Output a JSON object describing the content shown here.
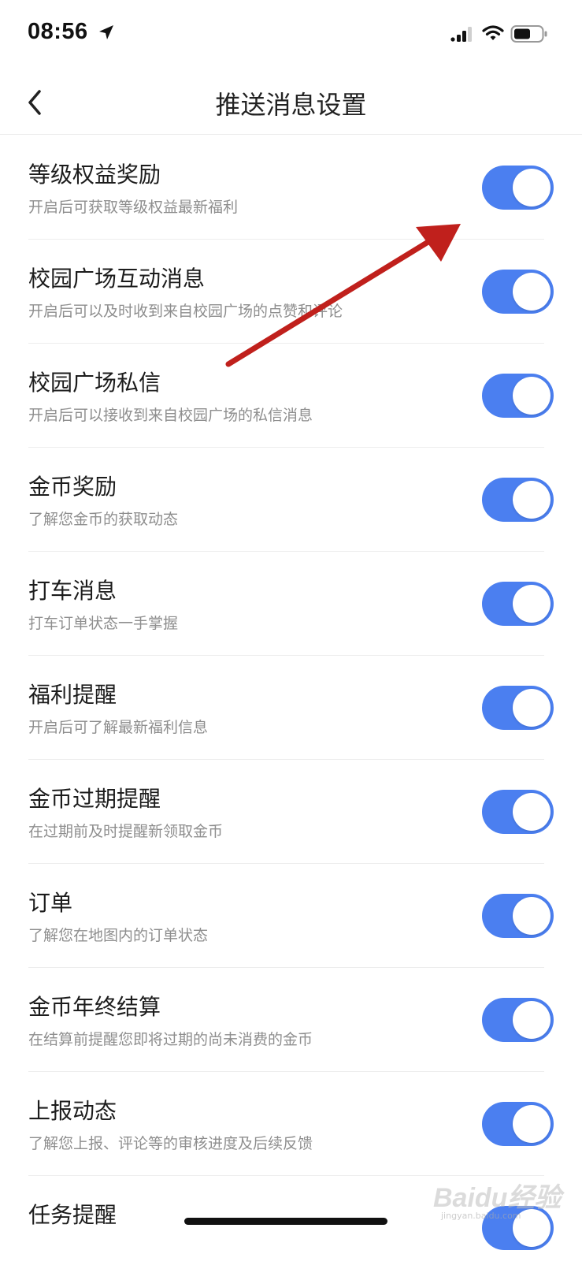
{
  "status_bar": {
    "time": "08:56",
    "icons": [
      "location-arrow-icon",
      "signal-icon",
      "wifi-icon",
      "battery-icon"
    ]
  },
  "nav": {
    "title": "推送消息设置",
    "back_icon": "chevron-left-icon"
  },
  "settings": [
    {
      "title": "等级权益奖励",
      "desc": "开启后可获取等级权益最新福利",
      "enabled": true
    },
    {
      "title": "校园广场互动消息",
      "desc": "开启后可以及时收到来自校园广场的点赞和评论",
      "enabled": true
    },
    {
      "title": "校园广场私信",
      "desc": "开启后可以接收到来自校园广场的私信消息",
      "enabled": true
    },
    {
      "title": "金币奖励",
      "desc": "了解您金币的获取动态",
      "enabled": true
    },
    {
      "title": "打车消息",
      "desc": "打车订单状态一手掌握",
      "enabled": true
    },
    {
      "title": "福利提醒",
      "desc": "开启后可了解最新福利信息",
      "enabled": true
    },
    {
      "title": "金币过期提醒",
      "desc": "在过期前及时提醒新领取金币",
      "enabled": true
    },
    {
      "title": "订单",
      "desc": "了解您在地图内的订单状态",
      "enabled": true
    },
    {
      "title": "金币年终结算",
      "desc": "在结算前提醒您即将过期的尚未消费的金币",
      "enabled": true
    },
    {
      "title": "上报动态",
      "desc": "了解您上报、评论等的审核进度及后续反馈",
      "enabled": true
    },
    {
      "title": "任务提醒",
      "desc": "",
      "enabled": true
    }
  ],
  "colors": {
    "toggle_on": "#4b7ff0",
    "annotation_arrow": "#c0201c"
  },
  "watermark": {
    "text": "Baidu经验",
    "sub": "jingyan.baidu.com"
  }
}
